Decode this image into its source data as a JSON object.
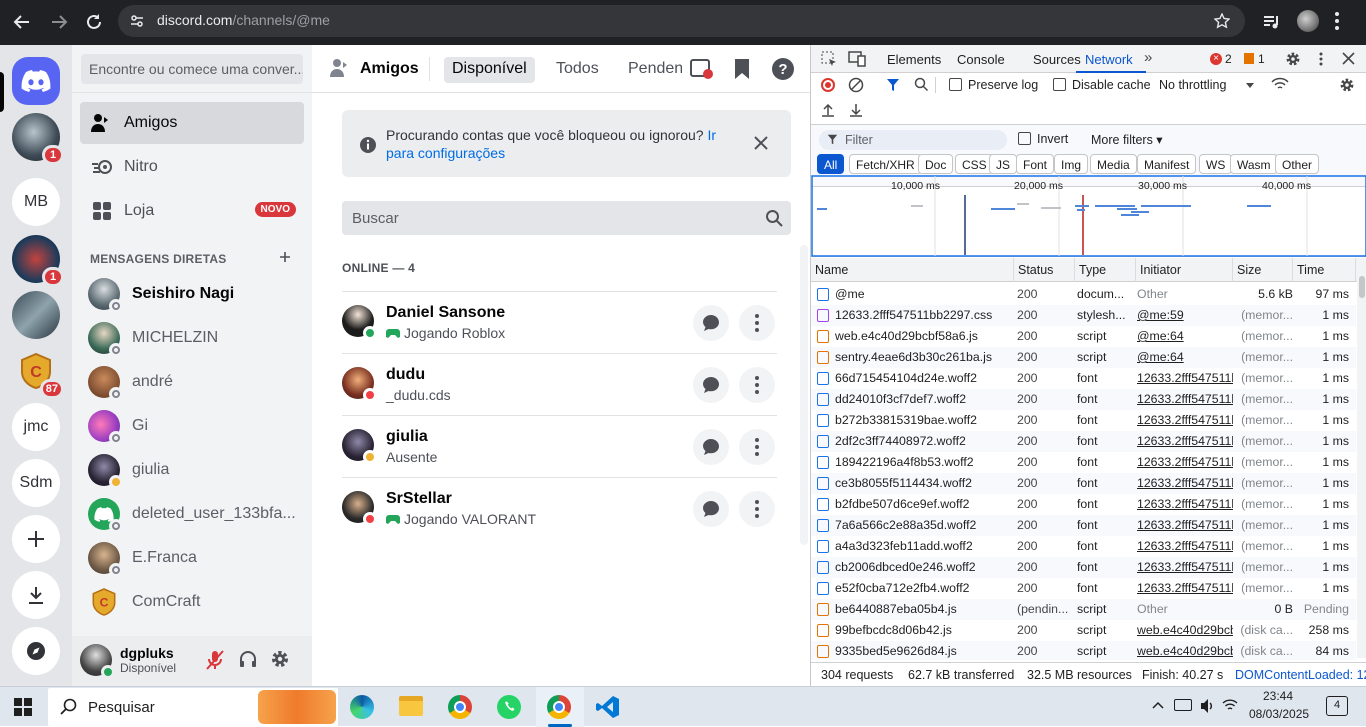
{
  "browser": {
    "url_host": "discord.com",
    "url_path": "/channels/@me"
  },
  "guilds": [
    {
      "label": "",
      "badge": "1"
    },
    {
      "label": "MB",
      "badge": ""
    },
    {
      "label": "",
      "badge": "1"
    },
    {
      "label": "",
      "badge": ""
    },
    {
      "label": "",
      "badge": "87"
    },
    {
      "label": "jmc",
      "badge": ""
    },
    {
      "label": "Sdm",
      "badge": ""
    }
  ],
  "sidebar": {
    "search_placeholder": "Encontre ou comece uma conver...",
    "nav": {
      "friends": "Amigos",
      "nitro": "Nitro",
      "shop": "Loja",
      "shop_badge": "NOVO"
    },
    "dm_header": "MENSAGENS DIRETAS",
    "dms": [
      {
        "name": "Seishiro Nagi",
        "status": "offline",
        "bold": true
      },
      {
        "name": "MICHELZIN",
        "status": "offline"
      },
      {
        "name": "andré",
        "status": "offline"
      },
      {
        "name": "Gi",
        "status": "offline"
      },
      {
        "name": "giulia",
        "status": "idle"
      },
      {
        "name": "deleted_user_133bfa...",
        "status": "offline"
      },
      {
        "name": "E.Franca",
        "status": "offline"
      },
      {
        "name": "ComCraft",
        "status": ""
      }
    ],
    "user": {
      "name": "dgpluks",
      "status": "Disponível"
    }
  },
  "friends": {
    "header": {
      "title": "Amigos",
      "tab_online": "Disponível",
      "tab_all": "Todos",
      "tab_pending": "Penden"
    },
    "notice": {
      "text": "Procurando contas que você bloqueou ou ignorou?",
      "link": "Ir para configurações"
    },
    "search_placeholder": "Buscar",
    "online_header": "ONLINE — 4",
    "list": [
      {
        "name": "Daniel Sansone",
        "activity": "Jogando Roblox",
        "game": true,
        "status": "on"
      },
      {
        "name": "dudu",
        "activity": "_dudu.cds",
        "game": false,
        "status": "dnd"
      },
      {
        "name": "giulia",
        "activity": "Ausente",
        "game": false,
        "status": "idle"
      },
      {
        "name": "SrStellar",
        "activity": "Jogando VALORANT",
        "game": true,
        "status": "dnd"
      }
    ]
  },
  "devtools": {
    "tabs": [
      "Elements",
      "Console",
      "Sources",
      "Network"
    ],
    "active_tab": "Network",
    "errors": "2",
    "warnings": "1",
    "preserve_log": "Preserve log",
    "disable_cache": "Disable cache",
    "throttling": "No throttling",
    "filter_placeholder": "Filter",
    "invert": "Invert",
    "more_filters": "More filters",
    "chips": [
      "All",
      "Fetch/XHR",
      "Doc",
      "CSS",
      "JS",
      "Font",
      "Img",
      "Media",
      "Manifest",
      "WS",
      "Wasm",
      "Other"
    ],
    "timeline_ticks": [
      "10,000 ms",
      "20,000 ms",
      "30,000 ms",
      "40,000 ms"
    ],
    "columns": [
      "Name",
      "Status",
      "Type",
      "Initiator",
      "Size",
      "Time"
    ],
    "rows": [
      {
        "name": "@me",
        "status": "200",
        "type": "docum...",
        "initiator": "Other",
        "size": "5.6 kB",
        "time": "97 ms"
      },
      {
        "name": "12633.2fff547511bb2297.css",
        "status": "200",
        "type": "stylesh...",
        "initiator": "@me:59",
        "size": "(memor...",
        "time": "1 ms"
      },
      {
        "name": "web.e4c40d29bcbf58a6.js",
        "status": "200",
        "type": "script",
        "initiator": "@me:64",
        "size": "(memor...",
        "time": "1 ms"
      },
      {
        "name": "sentry.4eae6d3b30c261ba.js",
        "status": "200",
        "type": "script",
        "initiator": "@me:64",
        "size": "(memor...",
        "time": "1 ms"
      },
      {
        "name": "66d715454104d24e.woff2",
        "status": "200",
        "type": "font",
        "initiator": "12633.2fff547511bb",
        "size": "(memor...",
        "time": "1 ms"
      },
      {
        "name": "dd24010f3cf7def7.woff2",
        "status": "200",
        "type": "font",
        "initiator": "12633.2fff547511bb",
        "size": "(memor...",
        "time": "1 ms"
      },
      {
        "name": "b272b33815319bae.woff2",
        "status": "200",
        "type": "font",
        "initiator": "12633.2fff547511bb",
        "size": "(memor...",
        "time": "1 ms"
      },
      {
        "name": "2df2c3ff74408972.woff2",
        "status": "200",
        "type": "font",
        "initiator": "12633.2fff547511bb",
        "size": "(memor...",
        "time": "1 ms"
      },
      {
        "name": "189422196a4f8b53.woff2",
        "status": "200",
        "type": "font",
        "initiator": "12633.2fff547511bb",
        "size": "(memor...",
        "time": "1 ms"
      },
      {
        "name": "ce3b8055f5114434.woff2",
        "status": "200",
        "type": "font",
        "initiator": "12633.2fff547511bb",
        "size": "(memor...",
        "time": "1 ms"
      },
      {
        "name": "b2fdbe507d6ce9ef.woff2",
        "status": "200",
        "type": "font",
        "initiator": "12633.2fff547511bb",
        "size": "(memor...",
        "time": "1 ms"
      },
      {
        "name": "7a6a566c2e88a35d.woff2",
        "status": "200",
        "type": "font",
        "initiator": "12633.2fff547511bb",
        "size": "(memor...",
        "time": "1 ms"
      },
      {
        "name": "a4a3d323feb11add.woff2",
        "status": "200",
        "type": "font",
        "initiator": "12633.2fff547511bb",
        "size": "(memor...",
        "time": "1 ms"
      },
      {
        "name": "cb2006dbced0e246.woff2",
        "status": "200",
        "type": "font",
        "initiator": "12633.2fff547511bb",
        "size": "(memor...",
        "time": "1 ms"
      },
      {
        "name": "e52f0cba712e2fb4.woff2",
        "status": "200",
        "type": "font",
        "initiator": "12633.2fff547511bb",
        "size": "(memor...",
        "time": "1 ms"
      },
      {
        "name": "be6440887eba05b4.js",
        "status": "(pendin...",
        "type": "script",
        "initiator": "Other",
        "size": "0 B",
        "time": "Pending"
      },
      {
        "name": "99befbcdc8d06b42.js",
        "status": "200",
        "type": "script",
        "initiator": "web.e4c40d29bcb",
        "size": "(disk ca...",
        "time": "258 ms"
      },
      {
        "name": "9335bed5e9626d84.js",
        "status": "200",
        "type": "script",
        "initiator": "web.e4c40d29bcb",
        "size": "(disk ca...",
        "time": "84 ms"
      }
    ],
    "summary": {
      "requests": "304 requests",
      "transferred": "62.7 kB transferred",
      "resources": "32.5 MB resources",
      "finish": "Finish: 40.27 s",
      "dcl": "DOMContentLoaded: 12"
    }
  },
  "taskbar": {
    "search": "Pesquisar",
    "time": "23:44",
    "date": "08/03/2025",
    "notif": "4"
  }
}
